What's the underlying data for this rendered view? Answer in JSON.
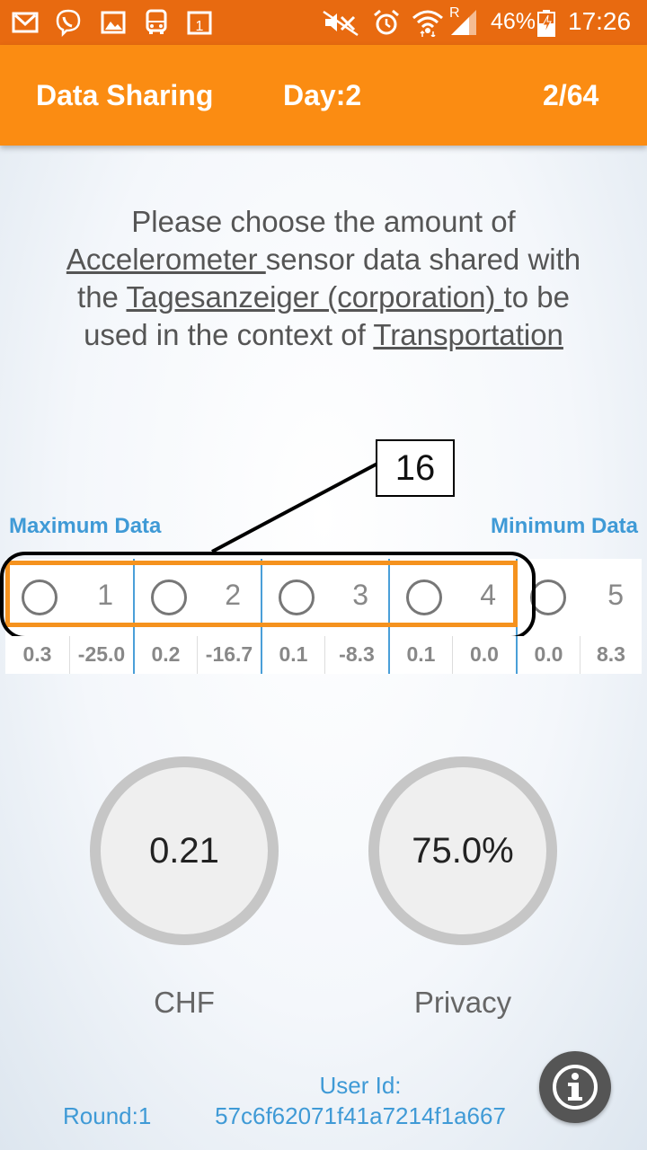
{
  "status_bar": {
    "battery": "46%",
    "time": "17:26",
    "network_letter": "R",
    "icons": [
      "gmail-icon",
      "viber-icon",
      "gallery-icon",
      "bus-icon",
      "calendar-icon",
      "mute-icon",
      "alarm-icon",
      "wifi-icon",
      "signal-icon",
      "battery-icon"
    ]
  },
  "header": {
    "title": "Data Sharing",
    "day": "Day:2",
    "progress": "2/64"
  },
  "question": {
    "part1": "Please choose the amount of",
    "sensor": "Accelerometer ",
    "part2": "sensor data shared with the ",
    "recipient": "Tagesanzeiger (corporation) ",
    "part3": "to be used in the context of ",
    "context": "Transportation "
  },
  "annotation": {
    "label": "16"
  },
  "scale": {
    "left_label": "Maximum Data",
    "right_label": "Minimum Data",
    "options": [
      {
        "num": "1",
        "values": [
          "0.3",
          "-25.0"
        ]
      },
      {
        "num": "2",
        "values": [
          "0.2",
          "-16.7"
        ]
      },
      {
        "num": "3",
        "values": [
          "0.1",
          "-8.3"
        ]
      },
      {
        "num": "4",
        "values": [
          "0.1",
          "0.0"
        ]
      },
      {
        "num": "5",
        "values": [
          "0.0",
          "8.3"
        ]
      }
    ]
  },
  "gauges": {
    "money": {
      "value": "0.21",
      "label": "CHF"
    },
    "privacy": {
      "value": "75.0%",
      "label": "Privacy"
    }
  },
  "footer": {
    "round": "Round:1",
    "user_id_label": "User Id:",
    "user_id": "57c6f62071f41a7214f1a667"
  },
  "colors": {
    "status_bar": "#e86a10",
    "app_bar": "#fb8c12",
    "accent_blue": "#3f9ad6",
    "selection": "#f5921e"
  }
}
